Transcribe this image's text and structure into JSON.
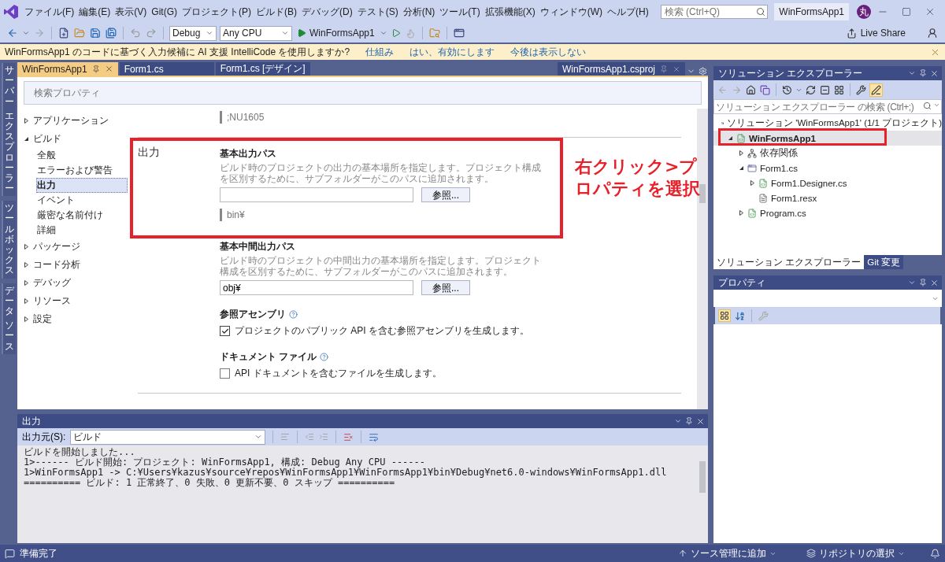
{
  "menu": {
    "items": [
      "ファイル(F)",
      "編集(E)",
      "表示(V)",
      "Git(G)",
      "プロジェクト(P)",
      "ビルド(B)",
      "デバッグ(D)",
      "テスト(S)",
      "分析(N)",
      "ツール(T)",
      "拡張機能(X)",
      "ウィンドウ(W)",
      "ヘルプ(H)"
    ]
  },
  "search": {
    "placeholder": "検索 (Ctrl+Q)"
  },
  "title": "WinFormsApp1",
  "avatar": "丸",
  "toolbar": {
    "configuration": "Debug",
    "platform": "Any CPU",
    "start": "WinFormsApp1",
    "live_share": "Live Share"
  },
  "infobar": {
    "message": "WinFormsApp1 のコードに基づく入力候補に AI 支援 IntelliCode を使用しますか?",
    "links": [
      "仕組み",
      "はい、有効にします",
      "今後は表示しない"
    ]
  },
  "side_tabs": [
    [
      "サーバー",
      "エクスプローラー"
    ],
    [
      "ツールボックス"
    ],
    [
      "データ",
      "ソース"
    ]
  ],
  "doc_tabs": [
    {
      "label": "WinFormsApp1",
      "selected": true
    },
    {
      "label": "Form1.cs",
      "selected": false
    },
    {
      "label": "Form1.cs [デザイン]",
      "selected": false
    }
  ],
  "preview_tab": {
    "label": "WinFormsApp1.csproj"
  },
  "property_page": {
    "search_placeholder": "検索プロパティ",
    "nav": [
      {
        "label": "アプリケーション",
        "expanded": false,
        "selected": false
      },
      {
        "label": "ビルド",
        "expanded": true,
        "selected": false,
        "children": [
          {
            "label": "全般",
            "selected": false
          },
          {
            "label": "エラーおよび警告",
            "selected": false
          },
          {
            "label": "出力",
            "selected": true
          },
          {
            "label": "イベント",
            "selected": false
          },
          {
            "label": "厳密な名前付け",
            "selected": false
          },
          {
            "label": "詳細",
            "selected": false
          }
        ]
      },
      {
        "label": "パッケージ",
        "expanded": false,
        "selected": false
      },
      {
        "label": "コード分析",
        "expanded": false,
        "selected": false
      },
      {
        "label": "デバッグ",
        "expanded": false,
        "selected": false
      },
      {
        "label": "リソース",
        "expanded": false,
        "selected": false
      },
      {
        "label": "設定",
        "expanded": false,
        "selected": false
      }
    ],
    "top_value": ";NU1605",
    "section_title": "出力",
    "properties": [
      {
        "kind": "path",
        "title": "基本出力パス",
        "description": "ビルド時のプロジェクトの出力の基本場所を指定します。プロジェクト構成を区別するために、サブフォルダーがこのパスに追加されます。",
        "button": "参照...",
        "hint": "bin¥"
      },
      {
        "kind": "path",
        "title": "基本中間出力パス",
        "description": "ビルド時のプロジェクトの中間出力の基本場所を指定します。プロジェクト構成を区別するために、サブフォルダーがこのパスに追加されます。",
        "value": "obj¥",
        "button": "参照..."
      },
      {
        "kind": "checkbox",
        "title": "参照アセンブリ",
        "label": "プロジェクトのパブリック API を含む参照アセンブリを生成します。",
        "checked": true
      },
      {
        "kind": "checkbox",
        "title": "ドキュメント ファイル",
        "label": "API ドキュメントを含むファイルを生成します。",
        "checked": false
      }
    ]
  },
  "annotation": {
    "text": "右クリック>プロパティを選択"
  },
  "solution_explorer": {
    "title": "ソリューション エクスプローラー",
    "search_placeholder": "ソリューション エクスプローラー の検索 (Ctrl+;)",
    "tree": [
      {
        "label": "ソリューション 'WinFormsApp1' (1/1 プロジェクト)",
        "kind": "solution",
        "selected": false,
        "children": [
          {
            "label": "WinFormsApp1",
            "kind": "project",
            "expanded": true,
            "selected": true,
            "children": [
              {
                "label": "依存関係",
                "kind": "dependencies",
                "expanded": false,
                "selected": false
              },
              {
                "label": "Form1.cs",
                "kind": "form",
                "expanded": true,
                "selected": false,
                "children": [
                  {
                    "label": "Form1.Designer.cs",
                    "kind": "csharp",
                    "expanded": false,
                    "selected": false
                  },
                  {
                    "label": "Form1.resx",
                    "kind": "resource",
                    "selected": false
                  }
                ]
              },
              {
                "label": "Program.cs",
                "kind": "csharp",
                "expanded": false,
                "selected": false
              }
            ]
          }
        ]
      }
    ],
    "bottom_tabs": [
      {
        "label": "ソリューション エクスプローラー",
        "selected": true
      },
      {
        "label": "Git 変更",
        "selected": false
      }
    ]
  },
  "properties_panel": {
    "title": "プロパティ"
  },
  "output": {
    "title": "出力",
    "source_label": "出力元(S):",
    "source": "ビルド",
    "lines": [
      "ビルドを開始しました...",
      "1>------ ビルド開始: プロジェクト: WinFormsApp1, 構成: Debug Any CPU ------",
      "1>WinFormsApp1 -> C:¥Users¥kazus¥source¥repos¥WinFormsApp1¥WinFormsApp1¥bin¥Debug¥net6.0-windows¥WinFormsApp1.dll",
      "========== ビルド: 1 正常終了、0 失敗、0 更新不要、0 スキップ =========="
    ]
  },
  "status": {
    "message": "準備完了",
    "items": [
      "ソース管理に追加",
      "リポジトリの選択"
    ]
  }
}
